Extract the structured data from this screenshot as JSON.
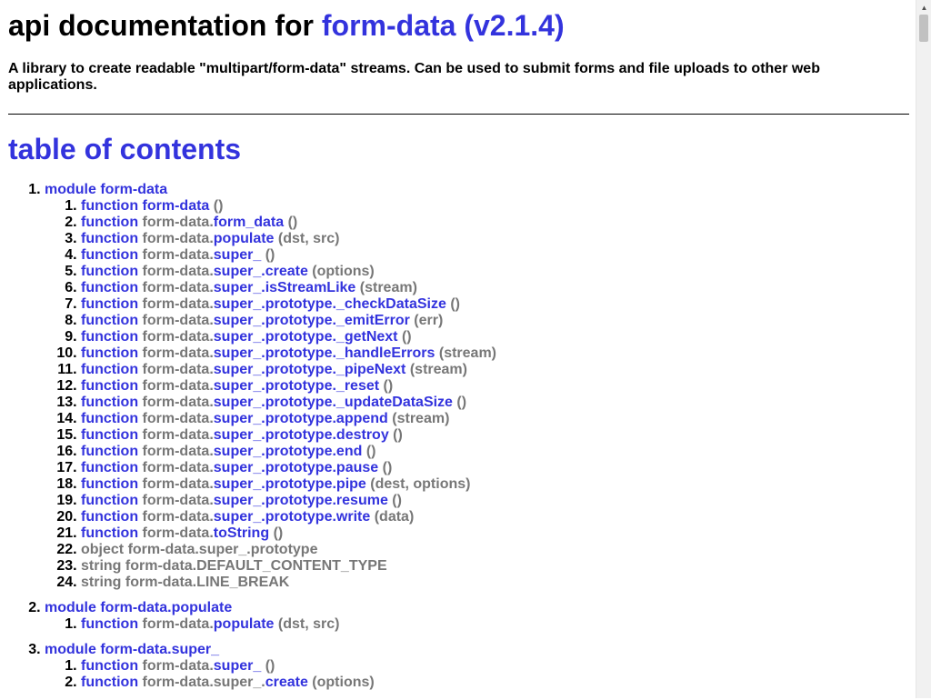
{
  "header": {
    "title_prefix": "api documentation for ",
    "package": "form-data (v2.1.4)",
    "description": "A library to create readable \"multipart/form-data\" streams. Can be used to submit forms and file uploads to other web applications."
  },
  "toc_title": "table of contents",
  "modules": [
    {
      "label": "module form-data",
      "items": [
        {
          "kind": "function",
          "prefix": "",
          "name": "form-data",
          "args": "()"
        },
        {
          "kind": "function",
          "prefix": "form-data.",
          "name": "form_data",
          "args": "()"
        },
        {
          "kind": "function",
          "prefix": "form-data.",
          "name": "populate",
          "args": "(dst, src)"
        },
        {
          "kind": "function",
          "prefix": "form-data.",
          "name": "super_",
          "args": "()"
        },
        {
          "kind": "function",
          "prefix": "form-data.",
          "name": "super_.create",
          "args": "(options)"
        },
        {
          "kind": "function",
          "prefix": "form-data.",
          "name": "super_.isStreamLike",
          "args": "(stream)"
        },
        {
          "kind": "function",
          "prefix": "form-data.",
          "name": "super_.prototype._checkDataSize",
          "args": "()"
        },
        {
          "kind": "function",
          "prefix": "form-data.",
          "name": "super_.prototype._emitError",
          "args": "(err)"
        },
        {
          "kind": "function",
          "prefix": "form-data.",
          "name": "super_.prototype._getNext",
          "args": "()"
        },
        {
          "kind": "function",
          "prefix": "form-data.",
          "name": "super_.prototype._handleErrors",
          "args": "(stream)"
        },
        {
          "kind": "function",
          "prefix": "form-data.",
          "name": "super_.prototype._pipeNext",
          "args": "(stream)"
        },
        {
          "kind": "function",
          "prefix": "form-data.",
          "name": "super_.prototype._reset",
          "args": "()"
        },
        {
          "kind": "function",
          "prefix": "form-data.",
          "name": "super_.prototype._updateDataSize",
          "args": "()"
        },
        {
          "kind": "function",
          "prefix": "form-data.",
          "name": "super_.prototype.append",
          "args": "(stream)"
        },
        {
          "kind": "function",
          "prefix": "form-data.",
          "name": "super_.prototype.destroy",
          "args": "()"
        },
        {
          "kind": "function",
          "prefix": "form-data.",
          "name": "super_.prototype.end",
          "args": "()"
        },
        {
          "kind": "function",
          "prefix": "form-data.",
          "name": "super_.prototype.pause",
          "args": "()"
        },
        {
          "kind": "function",
          "prefix": "form-data.",
          "name": "super_.prototype.pipe",
          "args": "(dest, options)"
        },
        {
          "kind": "function",
          "prefix": "form-data.",
          "name": "super_.prototype.resume",
          "args": "()"
        },
        {
          "kind": "function",
          "prefix": "form-data.",
          "name": "super_.prototype.write",
          "args": "(data)"
        },
        {
          "kind": "function",
          "prefix": "form-data.",
          "name": "toString",
          "args": "()"
        },
        {
          "kind": "object",
          "text": "object form-data.super_.prototype"
        },
        {
          "kind": "string",
          "text": "string form-data.DEFAULT_CONTENT_TYPE"
        },
        {
          "kind": "string",
          "text": "string form-data.LINE_BREAK"
        }
      ]
    },
    {
      "label": "module form-data.populate",
      "items": [
        {
          "kind": "function",
          "prefix": "form-data.",
          "name": "populate",
          "args": "(dst, src)"
        }
      ]
    },
    {
      "label": "module form-data.super_",
      "items": [
        {
          "kind": "function",
          "prefix": "form-data.",
          "name": "super_",
          "args": "()"
        },
        {
          "kind": "function",
          "prefix": "form-data.super_.",
          "name": "create",
          "args": "(options)"
        }
      ]
    }
  ]
}
